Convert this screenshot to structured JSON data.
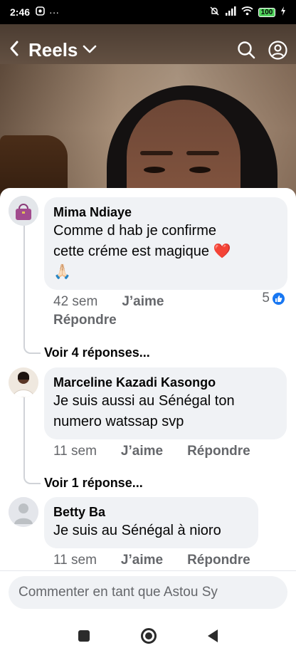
{
  "status_bar": {
    "time": "2:46",
    "more": "···",
    "battery": "100"
  },
  "header": {
    "back_icon": "chevron-left-icon",
    "title": "Reels",
    "dropdown_icon": "chevron-down-icon",
    "search_icon": "search-icon",
    "profile_icon": "profile-icon"
  },
  "comments": [
    {
      "author": "Mima Ndiaye",
      "lines": [
        "Comme d hab je confirme",
        "cette créme est magique ❤️",
        "🙏🏻"
      ],
      "time": "42 sem",
      "like_label": "J’aime",
      "reply_label": "Répondre",
      "reaction_count": "5",
      "view_replies": "Voir 4 réponses..."
    },
    {
      "author": "Marceline Kazadi Kasongo",
      "lines": [
        "Je suis aussi au Sénégal ton",
        "numero watssap svp"
      ],
      "time": "11 sem",
      "like_label": "J’aime",
      "reply_label": "Répondre",
      "view_replies": "Voir 1 réponse..."
    },
    {
      "author": "Betty Ba",
      "lines": [
        "Je suis au Sénégal à nioro"
      ],
      "time": "11 sem",
      "like_label": "J’aime",
      "reply_label": "Répondre"
    }
  ],
  "composer": {
    "placeholder": "Commenter en tant que Astou Sy"
  },
  "colors": {
    "bubble": "#f0f2f5",
    "meta_text": "#65676b",
    "like_blue": "#1877f2"
  }
}
